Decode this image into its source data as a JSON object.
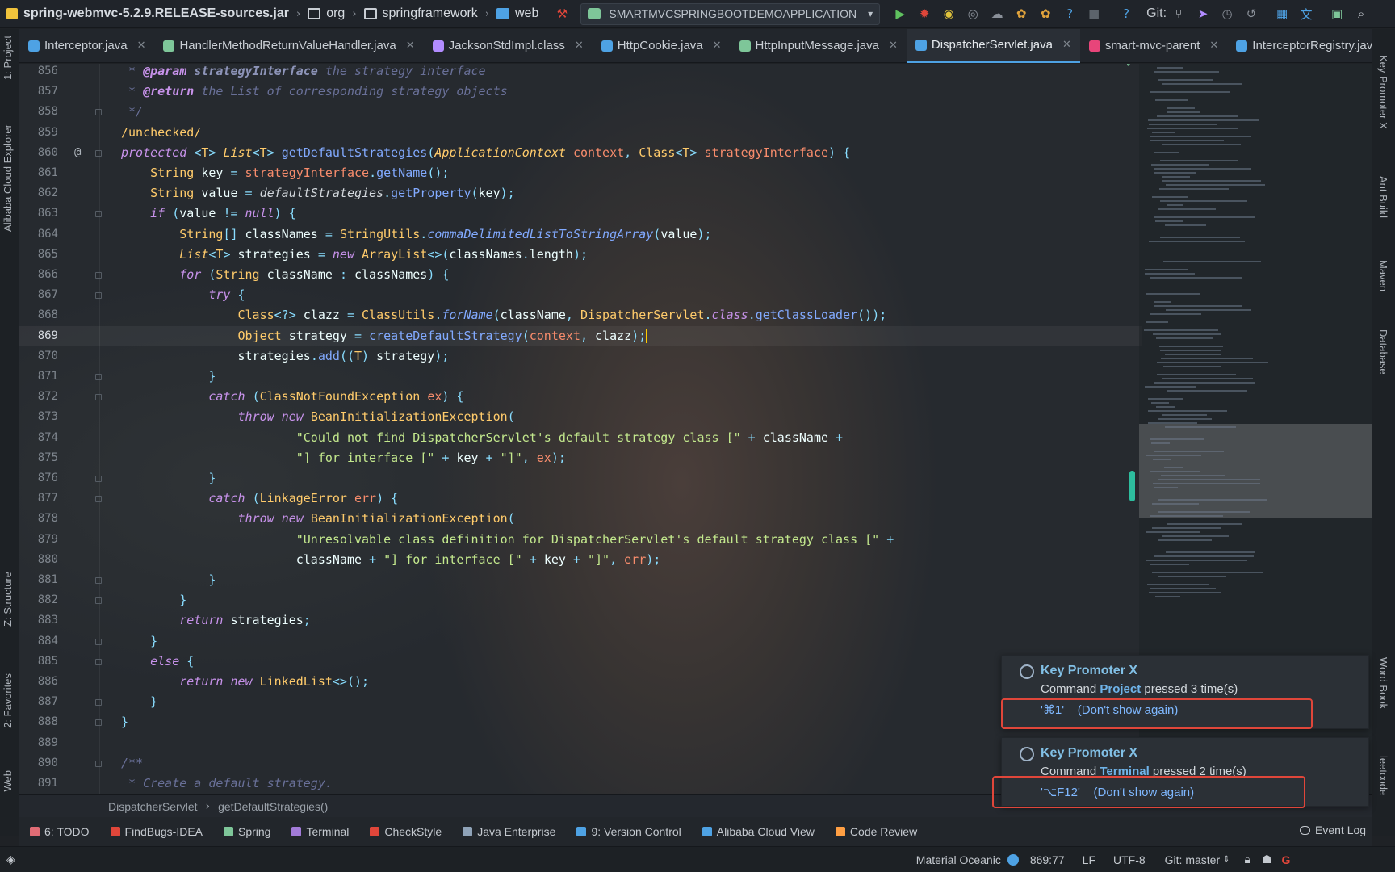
{
  "toolbar": {
    "project": "spring-webmvc-5.2.9.RELEASE-sources.jar",
    "path": [
      "org",
      "springframework",
      "web"
    ],
    "run_config": "SMARTMVCSPRINGBOOTDEMOAPPLICATION",
    "git_label": "Git:"
  },
  "tabs": [
    {
      "label": "Interceptor.java",
      "color": "#4ea2e4",
      "active": false
    },
    {
      "label": "HandlerMethodReturnValueHandler.java",
      "color": "#7ec699",
      "active": false
    },
    {
      "label": "JacksonStdImpl.class",
      "color": "#b28cff",
      "active": false
    },
    {
      "label": "HttpCookie.java",
      "color": "#4ea2e4",
      "active": false
    },
    {
      "label": "HttpInputMessage.java",
      "color": "#7ec699",
      "active": false
    },
    {
      "label": "DispatcherServlet.java",
      "color": "#4ea2e4",
      "active": true
    },
    {
      "label": "smart-mvc-parent",
      "color": "#e8457a",
      "active": false
    },
    {
      "label": "InterceptorRegistry.java",
      "color": "#4ea2e4",
      "active": false
    }
  ],
  "tabs_overflow": "3",
  "left_tools": {
    "project": "1: Project",
    "cloud": "Alibaba Cloud Explorer",
    "structure": "Z: Structure",
    "favorites": "2: Favorites",
    "web": "Web"
  },
  "right_tools": {
    "key_promoter": "Key Promoter X",
    "ant": "Ant Build",
    "maven": "Maven",
    "database": "Database",
    "wordbook": "Word Book",
    "leetcode": "leetcode"
  },
  "editor": {
    "current_line": 869,
    "lines": [
      {
        "n": 856,
        "html": "<span class=\"c\"> * </span><span class=\"ann\">@param</span><span class=\"c\"> </span><span class=\"c\" style=\"font-weight:bold;color:#8d94b8\">strategyInterface</span><span class=\"c\"> the strategy interface</span>"
      },
      {
        "n": 857,
        "html": "<span class=\"c\"> * </span><span class=\"ann\">@return</span><span class=\"c\"> the List of corresponding strategy objects</span>"
      },
      {
        "n": 858,
        "html": "<span class=\"c\"> */</span>",
        "fold": true
      },
      {
        "n": 859,
        "html": "<span class=\"t\">/unchecked/</span>"
      },
      {
        "n": 860,
        "html": "<span class=\"k\">protected</span> <span class=\"p\">&lt;</span><span class=\"t\">T</span><span class=\"p\">&gt;</span> <span class=\"t\" style=\"font-style:italic\">List</span><span class=\"p\">&lt;</span><span class=\"t\">T</span><span class=\"p\">&gt;</span> <span class=\"f\">getDefaultStrategies</span><span class=\"p\">(</span><span class=\"t\" style=\"font-style:italic\">ApplicationContext</span> <span class=\"pv\">context</span><span class=\"p\">,</span> <span class=\"t\">Class</span><span class=\"p\">&lt;</span><span class=\"t\">T</span><span class=\"p\">&gt;</span> <span class=\"pv\">strategyInterface</span><span class=\"p\">) {</span>",
        "fold": true,
        "at": true
      },
      {
        "n": 861,
        "html": "    <span class=\"t\">String</span> <span class=\"v\">key</span> <span class=\"p\">=</span> <span class=\"pv\">strategyInterface</span><span class=\"p\">.</span><span class=\"f\">getName</span><span class=\"p\">();</span>"
      },
      {
        "n": 862,
        "html": "    <span class=\"t\">String</span> <span class=\"v\">value</span> <span class=\"p\">=</span> <span class=\"w\" style=\"font-style:italic\">defaultStrategies</span><span class=\"p\">.</span><span class=\"f\">getProperty</span><span class=\"p\">(</span><span class=\"v\">key</span><span class=\"p\">);</span>"
      },
      {
        "n": 863,
        "html": "    <span class=\"k\">if</span> <span class=\"p\">(</span><span class=\"v\">value</span> <span class=\"p\">!=</span> <span class=\"k\">null</span><span class=\"p\">) {</span>",
        "fold": true
      },
      {
        "n": 864,
        "html": "        <span class=\"t\">String</span><span class=\"p\">[]</span> <span class=\"v\">classNames</span> <span class=\"p\">=</span> <span class=\"t\">StringUtils</span><span class=\"p\">.</span><span class=\"f\" style=\"font-style:italic\">commaDelimitedListToStringArray</span><span class=\"p\">(</span><span class=\"v\">value</span><span class=\"p\">);</span>"
      },
      {
        "n": 865,
        "html": "        <span class=\"t\" style=\"font-style:italic\">List</span><span class=\"p\">&lt;</span><span class=\"t\">T</span><span class=\"p\">&gt;</span> <span class=\"v\">strategies</span> <span class=\"p\">=</span> <span class=\"k\">new</span> <span class=\"t\">ArrayList</span><span class=\"p\">&lt;&gt;(</span><span class=\"v\">classNames</span><span class=\"p\">.</span><span class=\"v\">length</span><span class=\"p\">);</span>"
      },
      {
        "n": 866,
        "html": "        <span class=\"k\">for</span> <span class=\"p\">(</span><span class=\"t\">String</span> <span class=\"v\">className</span> <span class=\"p\">:</span> <span class=\"v\">classNames</span><span class=\"p\">) {</span>",
        "fold": true
      },
      {
        "n": 867,
        "html": "            <span class=\"k\">try</span> <span class=\"p\">{</span>",
        "fold": true
      },
      {
        "n": 868,
        "html": "                <span class=\"t\">Class</span><span class=\"p\">&lt;?&gt;</span> <span class=\"v\">clazz</span> <span class=\"p\">=</span> <span class=\"t\">ClassUtils</span><span class=\"p\">.</span><span class=\"f\" style=\"font-style:italic\">forName</span><span class=\"p\">(</span><span class=\"v\">className</span><span class=\"p\">,</span> <span class=\"t\">DispatcherServlet</span><span class=\"p\">.</span><span class=\"k\">class</span><span class=\"p\">.</span><span class=\"f\">getClassLoader</span><span class=\"p\">());</span>"
      },
      {
        "n": 869,
        "html": "                <span class=\"t\">Object</span> <span class=\"v\">strategy</span> <span class=\"p\">=</span> <span class=\"f\">createDefaultStrategy</span><span class=\"p\">(</span><span class=\"pv\">context</span><span class=\"p\">,</span> <span class=\"v\">clazz</span><span class=\"p\">);</span><span class=\"caret\"></span>",
        "current": true
      },
      {
        "n": 870,
        "html": "                <span class=\"v\">strategies</span><span class=\"p\">.</span><span class=\"f\">add</span><span class=\"p\">((</span><span class=\"t\">T</span><span class=\"p\">)</span> <span class=\"v\">strategy</span><span class=\"p\">);</span>"
      },
      {
        "n": 871,
        "html": "            <span class=\"p\">}</span>",
        "fold": true
      },
      {
        "n": 872,
        "html": "            <span class=\"k\">catch</span> <span class=\"p\">(</span><span class=\"t\">ClassNotFoundException</span> <span class=\"pv\">ex</span><span class=\"p\">) {</span>",
        "fold": true
      },
      {
        "n": 873,
        "html": "                <span class=\"k\">throw</span> <span class=\"k\">new</span> <span class=\"t\">BeanInitializationException</span><span class=\"p\">(</span>"
      },
      {
        "n": 874,
        "html": "                        <span class=\"s\">\"Could not find DispatcherServlet's default strategy class [\"</span> <span class=\"p\">+</span> <span class=\"v\">className</span> <span class=\"p\">+</span>"
      },
      {
        "n": 875,
        "html": "                        <span class=\"s\">\"] for interface [\"</span> <span class=\"p\">+</span> <span class=\"v\">key</span> <span class=\"p\">+</span> <span class=\"s\">\"]\"</span><span class=\"p\">,</span> <span class=\"pv\">ex</span><span class=\"p\">);</span>"
      },
      {
        "n": 876,
        "html": "            <span class=\"p\">}</span>",
        "fold": true
      },
      {
        "n": 877,
        "html": "            <span class=\"k\">catch</span> <span class=\"p\">(</span><span class=\"t\">LinkageError</span> <span class=\"pv\">err</span><span class=\"p\">) {</span>",
        "fold": true
      },
      {
        "n": 878,
        "html": "                <span class=\"k\">throw</span> <span class=\"k\">new</span> <span class=\"t\">BeanInitializationException</span><span class=\"p\">(</span>"
      },
      {
        "n": 879,
        "html": "                        <span class=\"s\">\"Unresolvable class definition for DispatcherServlet's default strategy class [\"</span> <span class=\"p\">+</span>"
      },
      {
        "n": 880,
        "html": "                        <span class=\"v\">className</span> <span class=\"p\">+</span> <span class=\"s\">\"] for interface [\"</span> <span class=\"p\">+</span> <span class=\"v\">key</span> <span class=\"p\">+</span> <span class=\"s\">\"]\"</span><span class=\"p\">,</span> <span class=\"pv\">err</span><span class=\"p\">);</span>"
      },
      {
        "n": 881,
        "html": "            <span class=\"p\">}</span>",
        "fold": true
      },
      {
        "n": 882,
        "html": "        <span class=\"p\">}</span>",
        "fold": true
      },
      {
        "n": 883,
        "html": "        <span class=\"k\">return</span> <span class=\"v\">strategies</span><span class=\"p\">;</span>"
      },
      {
        "n": 884,
        "html": "    <span class=\"p\">}</span>",
        "fold": true
      },
      {
        "n": 885,
        "html": "    <span class=\"k\">else</span> <span class=\"p\">{</span>",
        "fold": true
      },
      {
        "n": 886,
        "html": "        <span class=\"k\">return</span> <span class=\"k\">new</span> <span class=\"t\">LinkedList</span><span class=\"p\">&lt;&gt;();</span>"
      },
      {
        "n": 887,
        "html": "    <span class=\"p\">}</span>",
        "fold": true
      },
      {
        "n": 888,
        "html": "<span class=\"p\">}</span>",
        "fold": true
      },
      {
        "n": 889,
        "html": ""
      },
      {
        "n": 890,
        "html": "<span class=\"c\">/**</span>",
        "fold": true
      },
      {
        "n": 891,
        "html": "<span class=\"c\"> * Create a default strategy.</span>"
      }
    ]
  },
  "breadcrumb": {
    "class": "DispatcherServlet",
    "method": "getDefaultStrategies()"
  },
  "tool_windows": [
    {
      "label": "6: TODO",
      "color": "#e06c75"
    },
    {
      "label": "FindBugs-IDEA",
      "color": "#e0463a"
    },
    {
      "label": "Spring",
      "color": "#7ec699"
    },
    {
      "label": "Terminal",
      "color": "#a27bd8"
    },
    {
      "label": "CheckStyle",
      "color": "#e0463a"
    },
    {
      "label": "Java Enterprise",
      "color": "#8fa3b8"
    },
    {
      "label": "9: Version Control",
      "color": "#4ea2e4"
    },
    {
      "label": "Alibaba Cloud View",
      "color": "#4ea2e4"
    },
    {
      "label": "Code Review",
      "color": "#ff9f43"
    }
  ],
  "event_log": "Event Log",
  "status": {
    "theme": "Material Oceanic",
    "position": "869:77",
    "line_sep": "LF",
    "encoding": "UTF-8",
    "git": "Git: master"
  },
  "notifications": [
    {
      "title": "Key Promoter X",
      "pre": "Command ",
      "cmd": "Project",
      "post": " pressed 3 time(s)",
      "shortcut": "'⌘1'",
      "action": "(Don't show again)"
    },
    {
      "title": "Key Promoter X",
      "pre": "Command ",
      "cmd": "Terminal",
      "post": " pressed 2 time(s)",
      "shortcut": "'⌥F12'",
      "action": "(Don't show again)"
    }
  ]
}
